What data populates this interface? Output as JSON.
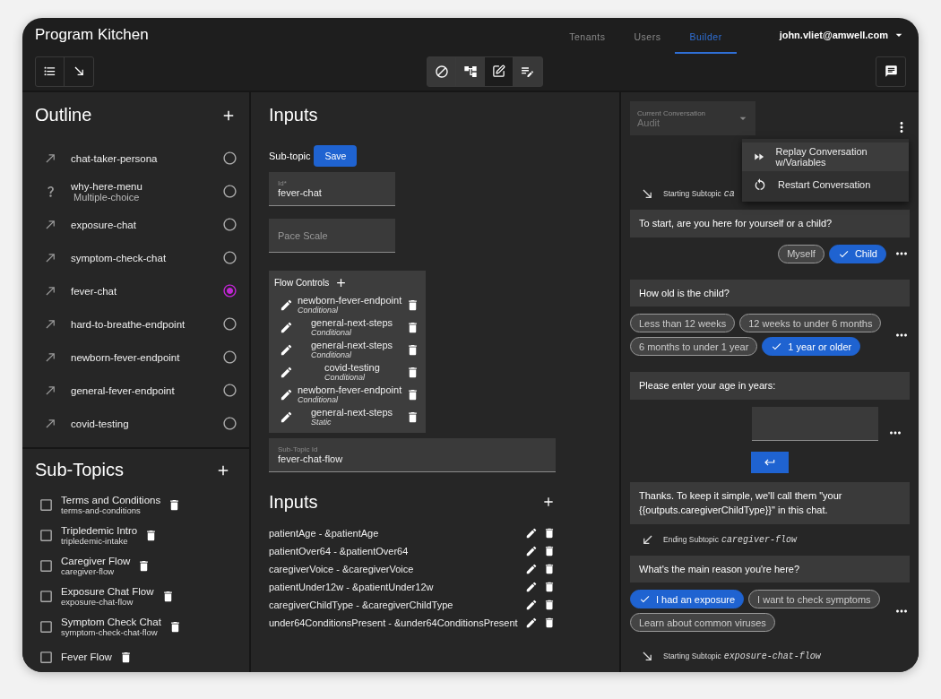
{
  "app": {
    "title": "Program Kitchen",
    "nav": [
      {
        "label": "Tenants",
        "selected": false
      },
      {
        "label": "Users",
        "selected": false
      },
      {
        "label": "Builder",
        "selected": true
      }
    ],
    "user": "john.vliet@amwell.com"
  },
  "toolbar": {
    "modes": [
      {
        "kind": "disable",
        "selected": false
      },
      {
        "kind": "tree",
        "selected": false
      },
      {
        "kind": "edit",
        "selected": true
      },
      {
        "kind": "notes",
        "selected": false
      }
    ]
  },
  "outline": {
    "title": "Outline",
    "items": [
      {
        "kind": "link",
        "label": "chat-taker-persona",
        "selected": false
      },
      {
        "kind": "question",
        "label": "why-here-menu",
        "sublabel": "Multiple-choice",
        "selected": false
      },
      {
        "kind": "link",
        "label": "exposure-chat",
        "selected": false
      },
      {
        "kind": "link",
        "label": "symptom-check-chat",
        "selected": false
      },
      {
        "kind": "link",
        "label": "fever-chat",
        "selected": true
      },
      {
        "kind": "link",
        "label": "hard-to-breathe-endpoint",
        "selected": false
      },
      {
        "kind": "link",
        "label": "newborn-fever-endpoint",
        "selected": false
      },
      {
        "kind": "link",
        "label": "general-fever-endpoint",
        "selected": false
      },
      {
        "kind": "link",
        "label": "covid-testing",
        "selected": false
      }
    ]
  },
  "subtopics": {
    "title": "Sub-Topics",
    "items": [
      {
        "title": "Terms and Conditions",
        "slug": "terms-and-conditions",
        "checked": false
      },
      {
        "title": "Tripledemic Intro",
        "slug": "tripledemic-intake",
        "checked": false
      },
      {
        "title": "Caregiver Flow",
        "slug": "caregiver-flow",
        "checked": false
      },
      {
        "title": "Exposure Chat Flow",
        "slug": "exposure-chat-flow",
        "checked": false
      },
      {
        "title": "Symptom Check Chat",
        "slug": "symptom-check-chat-flow",
        "checked": false
      },
      {
        "title": "Fever Flow",
        "checked": false
      }
    ]
  },
  "editor": {
    "title": "Inputs",
    "subtopic_label": "Sub-topic",
    "save": "Save",
    "id_field": {
      "label": "Id*",
      "value": "fever-chat"
    },
    "pace_field": {
      "placeholder": "Pace Scale"
    },
    "flow_controls": {
      "title": "Flow Controls",
      "items": [
        {
          "name": "newborn-fever-endpoint",
          "type": "Conditional",
          "children": [
            {
              "name": "general-next-steps",
              "type": "Conditional"
            },
            {
              "name": "general-next-steps",
              "type": "Conditional",
              "children": [
                {
                  "name": "covid-testing",
                  "type": "Conditional"
                }
              ]
            }
          ]
        },
        {
          "name": "newborn-fever-endpoint",
          "type": "Conditional",
          "children": [
            {
              "name": "general-next-steps",
              "type": "Static"
            }
          ]
        }
      ]
    },
    "subtopic_id_field": {
      "label": "Sub-Topic Id",
      "value": "fever-chat-flow"
    },
    "inputs": {
      "title": "Inputs",
      "items": [
        "patientAge - &patientAge",
        "patientOver64 - &patientOver64",
        "caregiverVoice - &caregiverVoice",
        "patientUnder12w - &patientUnder12w",
        "caregiverChildType - &caregiverChildType",
        "under64ConditionsPresent - &under64ConditionsPresent"
      ]
    }
  },
  "conversation": {
    "selector": {
      "label": "Current Conversation",
      "value": "Audit"
    },
    "menu": [
      {
        "kind": "replay",
        "label": "Replay Conversation w/Variables"
      },
      {
        "kind": "restart",
        "label": "Restart Conversation"
      }
    ],
    "messages": [
      {
        "kind": "subtopic_start",
        "prefix": "Starting Subtopic",
        "code": "ca"
      },
      {
        "kind": "question",
        "text": "To start, are you here for yourself or a child?"
      },
      {
        "kind": "choices",
        "right_aligned": true,
        "options": [
          {
            "label": "Myself",
            "selected": false
          },
          {
            "label": "Child",
            "selected": true
          }
        ]
      },
      {
        "kind": "question",
        "text": "How old is the child?"
      },
      {
        "kind": "choices",
        "right_aligned": false,
        "options": [
          {
            "label": "Less than 12 weeks",
            "selected": false
          },
          {
            "label": "12 weeks to under 6 months",
            "selected": false
          },
          {
            "label": "6 months to under 1 year",
            "selected": false
          },
          {
            "label": "1 year or older",
            "selected": true
          }
        ]
      },
      {
        "kind": "question",
        "text": "Please enter your age in years:"
      },
      {
        "kind": "text_input"
      },
      {
        "kind": "question",
        "text": "Thanks. To keep it simple, we'll call them \"your {{outputs.caregiverChildType}}\" in this chat."
      },
      {
        "kind": "subtopic_end",
        "prefix": "Ending Subtopic",
        "code": "caregiver-flow"
      },
      {
        "kind": "question",
        "text": "What's the main reason you're here?"
      },
      {
        "kind": "choices",
        "right_aligned": false,
        "options": [
          {
            "label": "I had an exposure",
            "selected": true
          },
          {
            "label": "I want to check symptoms",
            "selected": false
          },
          {
            "label": "Learn about common viruses",
            "selected": false
          }
        ]
      },
      {
        "kind": "subtopic_start",
        "prefix": "Starting Subtopic",
        "code": "exposure-chat-flow"
      }
    ]
  }
}
